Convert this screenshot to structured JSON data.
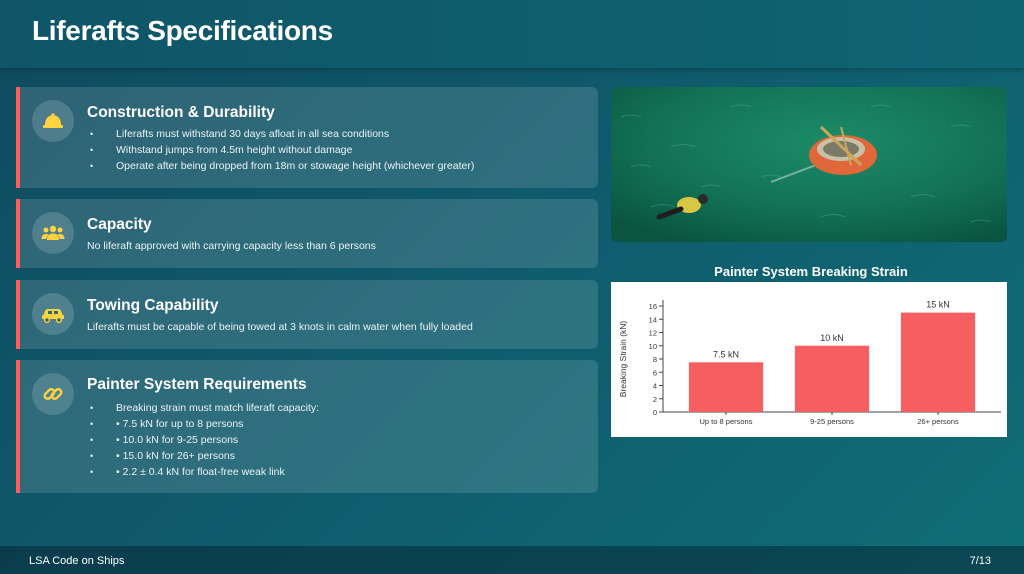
{
  "slide": {
    "title": "Liferafts Specifications",
    "footer_left": "LSA Code on Ships",
    "footer_right": "7/13"
  },
  "cards": [
    {
      "icon": "hard-hat-icon",
      "title": "Construction & Durability",
      "bullets": [
        "Liferafts must withstand 30 days afloat in all sea conditions",
        "Withstand jumps from 4.5m height without damage",
        "Operate after being dropped from 18m or stowage height (whichever greater)"
      ]
    },
    {
      "icon": "users-icon",
      "title": "Capacity",
      "text": "No liferaft approved with carrying capacity less than 6 persons"
    },
    {
      "icon": "truck-icon",
      "title": "Towing Capability",
      "text": "Liferafts must be capable of being towed at 3 knots in calm water when fully loaded"
    },
    {
      "icon": "link-icon",
      "title": "Painter System Requirements",
      "bullets": [
        "Breaking strain must match liferaft capacity:",
        "• 7.5 kN for up to 8 persons",
        "• 10.0 kN for 9-25 persons",
        "• 15.0 kN for 26+ persons",
        "• 2.2 ± 0.4 kN for float-free weak link"
      ]
    }
  ],
  "colors": {
    "accent": "#ff5d62",
    "bar": "#f65e5f"
  },
  "chart_data": {
    "type": "bar",
    "title": "Painter System Breaking Strain",
    "categories": [
      "Up to 8 persons",
      "9-25 persons",
      "26+ persons"
    ],
    "values": [
      7.5,
      10,
      15
    ],
    "data_labels": [
      "7.5 kN",
      "10 kN",
      "15 kN"
    ],
    "ylabel": "Breaking Strain (kN)",
    "xlabel": "",
    "ylim": [
      0,
      16
    ],
    "yticks": [
      0,
      2,
      4,
      6,
      8,
      10,
      12,
      14,
      16
    ],
    "grid": false
  }
}
